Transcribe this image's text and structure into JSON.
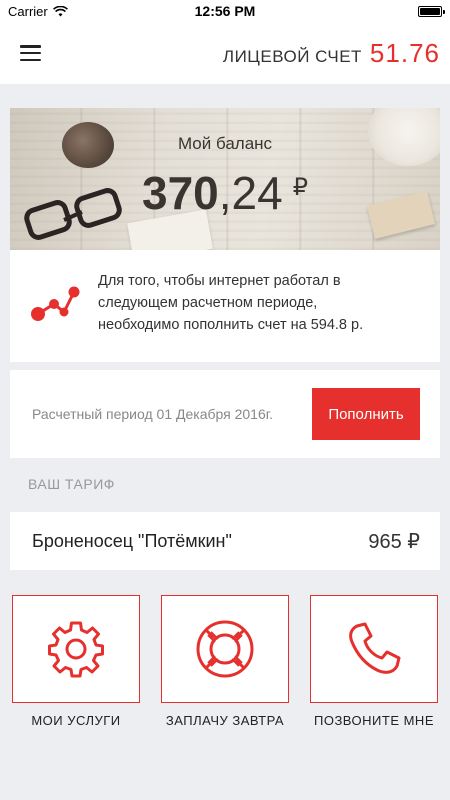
{
  "status_bar": {
    "carrier": "Carrier",
    "time": "12:56 PM"
  },
  "header": {
    "account_label": "ЛИЦЕВОЙ СЧЕТ",
    "account_number": "51.76"
  },
  "balance": {
    "title": "Мой баланс",
    "amount_int": "370",
    "amount_dec": ",24",
    "currency": "₽"
  },
  "notice": {
    "line1": "Для того, чтобы интернет работал в",
    "line2": "следующем расчетном периоде,",
    "line3": "необходимо пополнить счет на 594.8 р."
  },
  "period": {
    "text": "Расчетный период 01 Декабря 2016г.",
    "button": "Пополнить"
  },
  "tariff": {
    "header": "ВАШ ТАРИФ",
    "name": "Броненосец \"Потёмкин\"",
    "price": "965 ₽"
  },
  "actions": [
    {
      "label": "МОИ УСЛУГИ",
      "icon": "gear-icon"
    },
    {
      "label": "ЗАПЛАЧУ ЗАВТРА",
      "icon": "lifebuoy-icon"
    },
    {
      "label": "ПОЗВОНИТЕ МНЕ",
      "icon": "phone-icon"
    }
  ],
  "colors": {
    "accent": "#e5302d",
    "background": "#eceef1"
  }
}
